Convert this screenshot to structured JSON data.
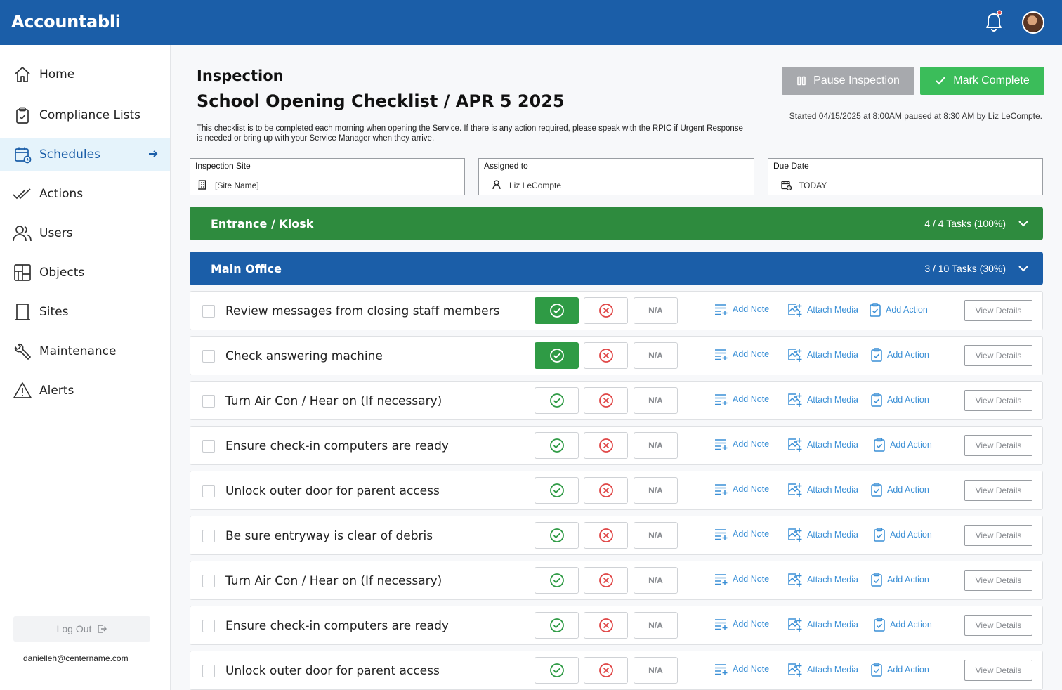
{
  "app": {
    "title": "Accountabli"
  },
  "sidebar": {
    "items": [
      {
        "label": "Home",
        "icon": "home-icon"
      },
      {
        "label": "Compliance Lists",
        "icon": "clipboard-icon"
      },
      {
        "label": "Schedules",
        "icon": "calendar-clock-icon",
        "active": true
      },
      {
        "label": "Actions",
        "icon": "double-check-icon"
      },
      {
        "label": "Users",
        "icon": "users-icon"
      },
      {
        "label": "Objects",
        "icon": "layout-icon"
      },
      {
        "label": "Sites",
        "icon": "building-icon"
      },
      {
        "label": "Maintenance",
        "icon": "wrench-icon"
      },
      {
        "label": "Alerts",
        "icon": "warning-icon"
      }
    ],
    "logout_label": "Log Out",
    "email": "danielleh@centername.com"
  },
  "page": {
    "eyebrow": "Inspection",
    "title": "School Opening Checklist / APR 5 2025",
    "description": "This checklist is to be completed each morning when opening the Service. If there is any action required, please speak with the RPIC if Urgent Response is needed or bring up with your Service Manager when they arrive.",
    "pause_label": "Pause Inspection",
    "complete_label": "Mark Complete",
    "started_text": "Started 04/15/2025 at 8:00AM paused at 8:30 AM by Liz LeCompte."
  },
  "fields": {
    "site": {
      "label": "Inspection Site",
      "value": "[Site Name]"
    },
    "assigned": {
      "label": "Assigned to",
      "value": "Liz LeCompte"
    },
    "due": {
      "label": "Due Date",
      "value": "TODAY"
    }
  },
  "sections": [
    {
      "title": "Entrance / Kiosk",
      "count": "4 / 4 Tasks (100%)",
      "color": "#2e8b3e"
    },
    {
      "title": "Main Office",
      "count": "3 / 10 Tasks (30%)",
      "color": "#1b5ea8"
    }
  ],
  "task_labels": {
    "na": "N/A",
    "add_note": "Add Note",
    "attach_media": "Attach Media",
    "add_action": "Add Action",
    "view_details": "View Details"
  },
  "tasks": [
    {
      "text": "Review messages from closing staff members",
      "passed": true
    },
    {
      "text": "Check answering machine",
      "passed": true
    },
    {
      "text": "Turn Air Con / Hear on (If necessary)",
      "passed": false
    },
    {
      "text": "Ensure check-in computers are ready",
      "passed": false
    },
    {
      "text": "Unlock outer door for parent access",
      "passed": false
    },
    {
      "text": "Be sure entryway is clear of debris",
      "passed": false
    },
    {
      "text": "Turn Air Con / Hear on (If necessary)",
      "passed": false
    },
    {
      "text": "Ensure check-in computers are ready",
      "passed": false
    },
    {
      "text": "Unlock outer door for parent access",
      "passed": false
    }
  ],
  "colors": {
    "brand": "#1b5ea8",
    "success": "#3bbd5a",
    "pass_active": "#2f9b45",
    "fail": "#e04646",
    "link": "#3a8fd6"
  }
}
